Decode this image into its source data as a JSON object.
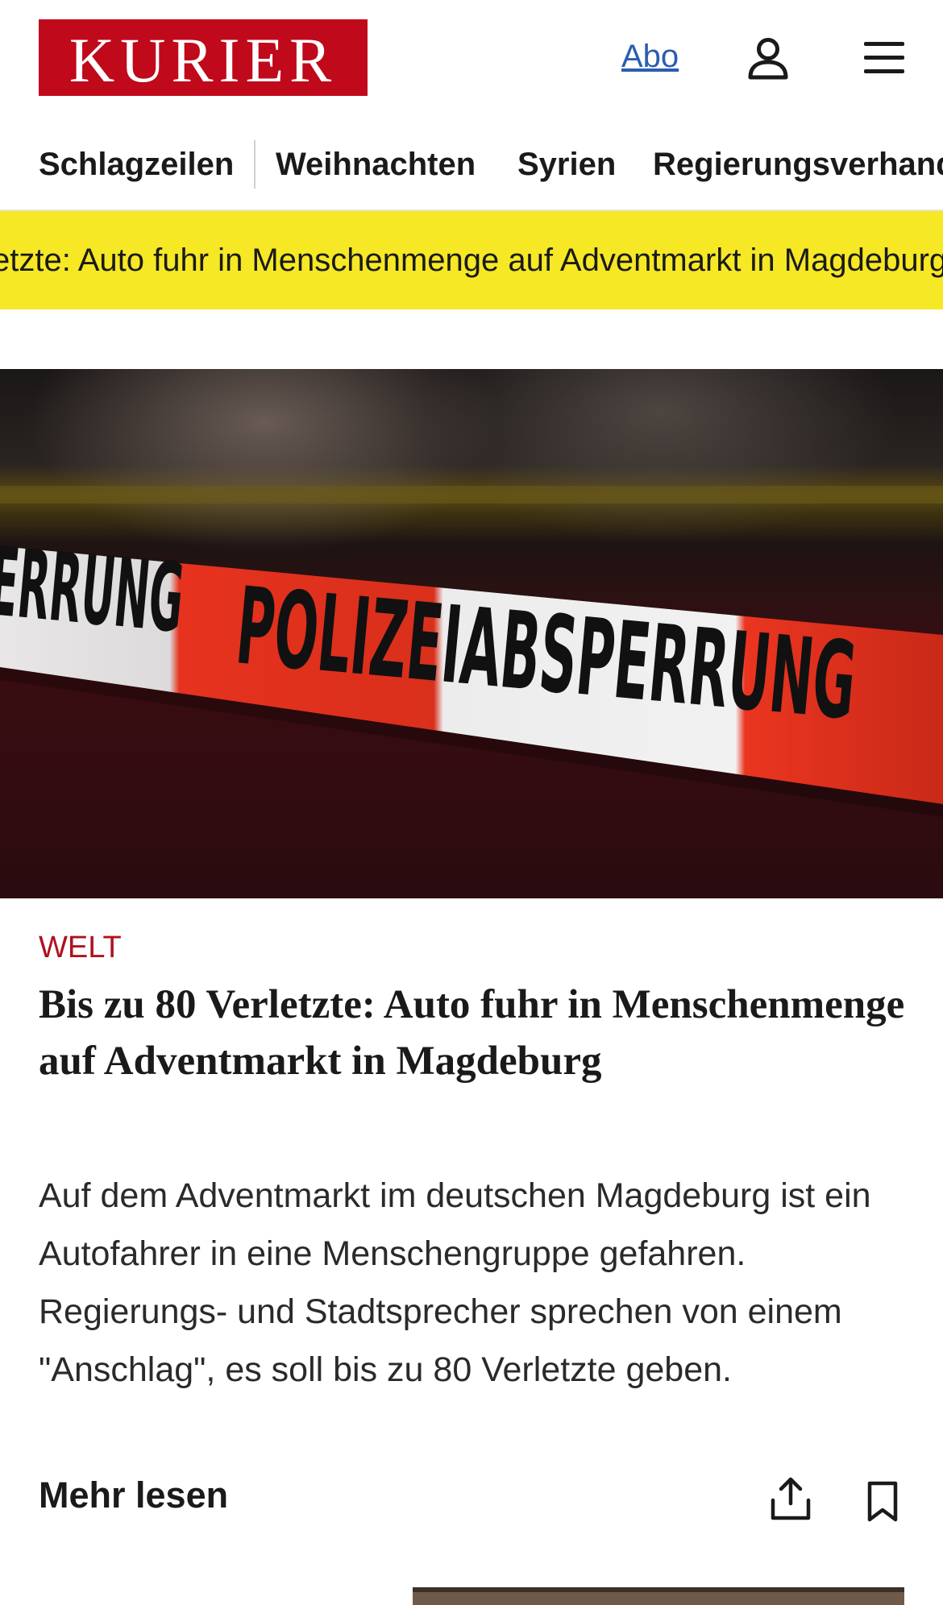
{
  "header": {
    "logo_text": "KURIER",
    "abo_label": "Abo",
    "brand_color": "#c0091b",
    "user_icon": "user-icon",
    "menu_icon": "hamburger-menu-icon"
  },
  "nav": {
    "items": [
      {
        "label": "Schlagzeilen"
      },
      {
        "label": "Weihnachten"
      },
      {
        "label": "Syrien"
      },
      {
        "label": "Regierungsverhandlungen"
      }
    ]
  },
  "ticker": {
    "text": "etzte: Auto fuhr in Menschenmenge auf Adventmarkt in Magdeburg",
    "background": "#f6e824"
  },
  "hero": {
    "tape_text_left": "ERRUNG",
    "tape_text_main": "POLIZEIABSPERRUNG"
  },
  "article": {
    "section": "WELT",
    "headline": "Bis zu 80 Verletzte: Auto fuhr in Menschenmenge auf Adventmarkt in Magdeburg",
    "teaser": "Auf dem Adventmarkt im deutschen Magdeburg ist ein Autofahrer in eine Menschengruppe gefahren. Regierungs- und Stadtsprecher sprechen von einem \"Anschlag\", es soll bis zu 80 Verletzte geben.",
    "more_label": "Mehr lesen",
    "share_icon": "share-icon",
    "bookmark_icon": "bookmark-icon",
    "section_color": "#b0101f"
  }
}
